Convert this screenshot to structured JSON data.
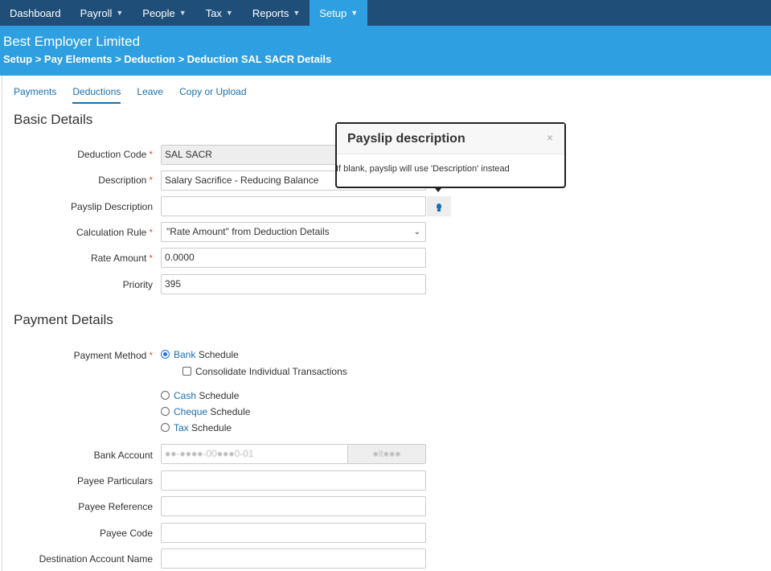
{
  "nav": {
    "items": [
      {
        "label": "Dashboard",
        "dropdown": false
      },
      {
        "label": "Payroll",
        "dropdown": true
      },
      {
        "label": "People",
        "dropdown": true
      },
      {
        "label": "Tax",
        "dropdown": true
      },
      {
        "label": "Reports",
        "dropdown": true
      },
      {
        "label": "Setup",
        "dropdown": true,
        "active": true
      }
    ]
  },
  "header": {
    "company": "Best Employer Limited",
    "breadcrumb": "Setup > Pay Elements > Deduction > Deduction SAL SACR Details"
  },
  "tabs": [
    "Payments",
    "Deductions",
    "Leave",
    "Copy or Upload"
  ],
  "active_tab": "Deductions",
  "basic": {
    "title": "Basic Details",
    "deduction_code_label": "Deduction Code",
    "deduction_code_value": "SAL SACR",
    "description_label": "Description",
    "description_value": "Salary Sacrifice - Reducing Balance",
    "payslip_label": "Payslip Description",
    "payslip_value": "",
    "calc_rule_label": "Calculation Rule",
    "calc_rule_value": "\"Rate Amount\" from Deduction Details",
    "rate_label": "Rate Amount",
    "rate_value": "0.0000",
    "priority_label": "Priority",
    "priority_value": "395"
  },
  "popover": {
    "title": "Payslip description",
    "close": "×",
    "body": "If blank, payslip will use 'Description' instead"
  },
  "payment": {
    "title": "Payment Details",
    "method_label": "Payment Method",
    "options": [
      {
        "link": "Bank",
        "rest": " Schedule",
        "checked": true
      },
      {
        "link": "Cash",
        "rest": " Schedule",
        "checked": false
      },
      {
        "link": "Cheque",
        "rest": " Schedule",
        "checked": false
      },
      {
        "link": "Tax",
        "rest": " Schedule",
        "checked": false
      }
    ],
    "consolidate_label": "Consolidate Individual Transactions",
    "bank_account_label": "Bank Account",
    "bank_account_value": "●●-●●●●-00●●●0-01",
    "bank_name_value": "●it●●●",
    "payee_particulars_label": "Payee Particulars",
    "payee_reference_label": "Payee Reference",
    "payee_code_label": "Payee Code",
    "destination_account_label": "Destination Account Name"
  },
  "required_mark": "*",
  "colors": {
    "nav_bg": "#1f4e79",
    "header_bg": "#2e9fe0",
    "link": "#1a6fb0",
    "required": "#d9534f"
  }
}
